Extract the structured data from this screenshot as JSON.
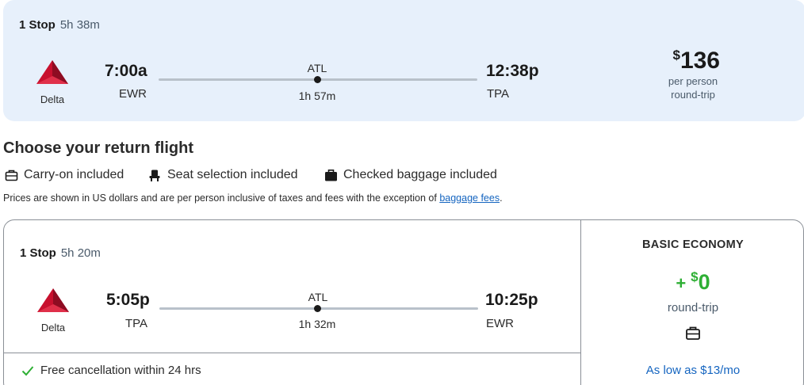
{
  "outbound": {
    "summary_stops": "1 Stop",
    "summary_duration": "5h 38m",
    "airline": "Delta",
    "depart_time": "7:00a",
    "depart_code": "EWR",
    "via": "ATL",
    "leg_duration": "1h 57m",
    "arrive_time": "12:38p",
    "arrive_code": "TPA",
    "price_currency": "$",
    "price_amount": "136",
    "price_sub1": "per person",
    "price_sub2": "round-trip"
  },
  "section_title": "Choose your return flight",
  "amenities": [
    {
      "label": "Carry-on included",
      "icon": "carry-on-icon"
    },
    {
      "label": "Seat selection included",
      "icon": "seat-icon"
    },
    {
      "label": "Checked baggage included",
      "icon": "checked-bag-icon"
    }
  ],
  "disclaimer": {
    "text": "Prices are shown in US dollars and are per person inclusive of taxes and fees with the exception of ",
    "link": "baggage fees",
    "suffix": "."
  },
  "return_flight": {
    "summary_stops": "1 Stop",
    "summary_duration": "5h 20m",
    "airline": "Delta",
    "depart_time": "5:05p",
    "depart_code": "TPA",
    "via": "ATL",
    "leg_duration": "1h 32m",
    "arrive_time": "10:25p",
    "arrive_code": "EWR",
    "free_cancel": "Free cancellation within 24 hrs",
    "fare_name": "BASIC ECONOMY",
    "fare_plus": "+",
    "fare_currency": "$",
    "fare_amount": "0",
    "fare_trip": "round-trip",
    "fare_link": "As low as $13/mo"
  },
  "colors": {
    "accent_blue": "#1565c0",
    "price_green": "#2eaf34",
    "card_bg": "#e7f0fb",
    "delta_red": "#c8102e"
  }
}
